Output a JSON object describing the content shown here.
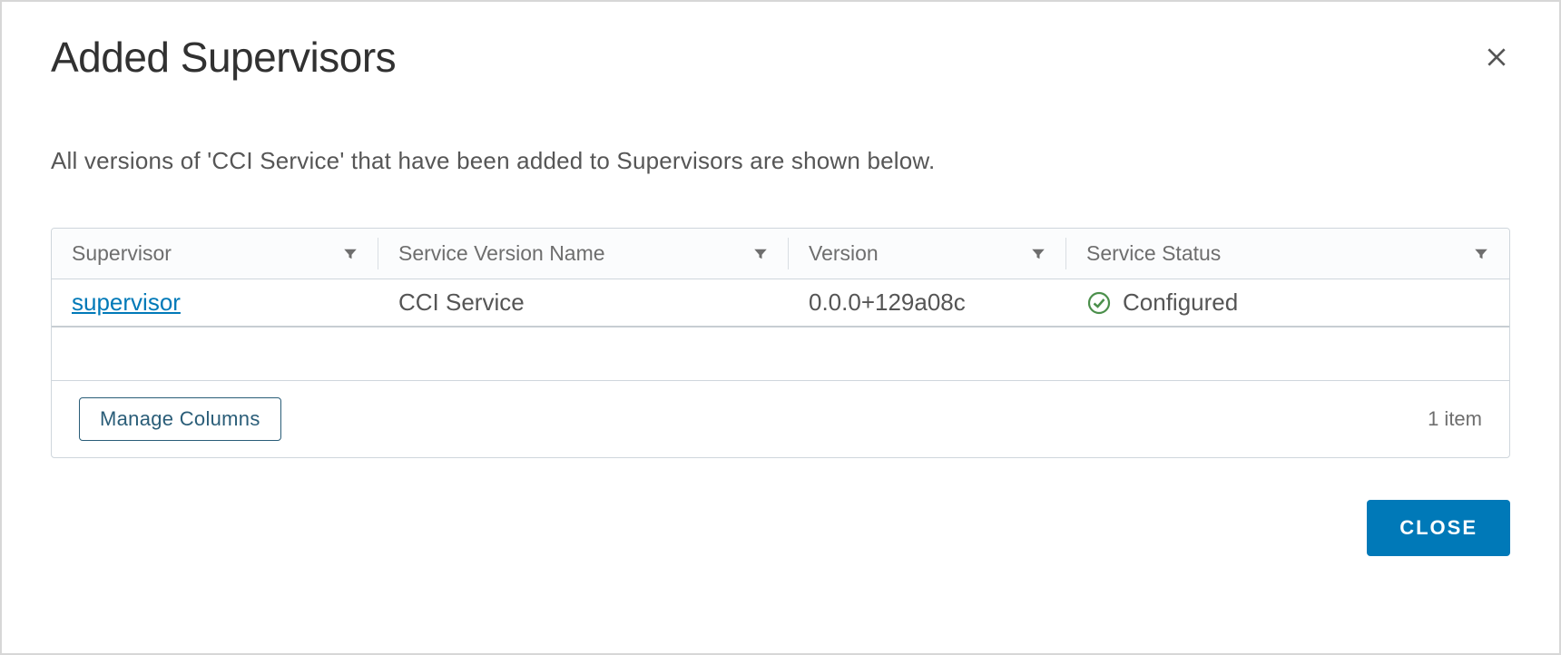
{
  "modal": {
    "title": "Added Supervisors",
    "description": "All versions of 'CCI Service' that have been added to Supervisors are shown below."
  },
  "table": {
    "columns": {
      "supervisor": "Supervisor",
      "service_version_name": "Service Version Name",
      "version": "Version",
      "service_status": "Service Status"
    },
    "rows": [
      {
        "supervisor": "supervisor",
        "service_version_name": "CCI Service",
        "version": "0.0.0+129a08c",
        "service_status": "Configured"
      }
    ],
    "footer": {
      "manage_columns": "Manage Columns",
      "item_count": "1 item"
    }
  },
  "actions": {
    "close": "CLOSE"
  }
}
